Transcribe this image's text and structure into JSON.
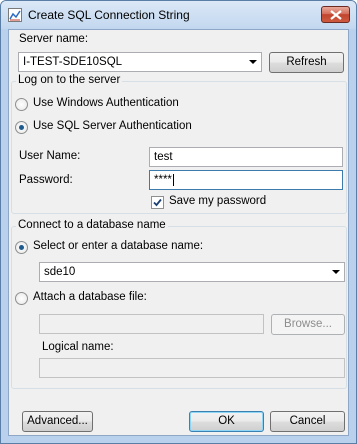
{
  "window": {
    "title": "Create SQL Connection String"
  },
  "server": {
    "label": "Server name:",
    "value": "I-TEST-SDE10SQL",
    "refresh_label": "Refresh"
  },
  "logon": {
    "group_label": "Log on to the server",
    "windows_auth_label": "Use Windows Authentication",
    "sql_auth_label": "Use SQL Server Authentication",
    "selected": "sql",
    "username_label": "User Name:",
    "username_value": "test",
    "password_label": "Password:",
    "password_value": "****",
    "save_password_label": "Save my password",
    "save_password_checked": true
  },
  "database": {
    "group_label": "Connect to a database name",
    "select_label": "Select or enter a database name:",
    "select_value": "sde10",
    "attach_label": "Attach a database file:",
    "attach_value": "",
    "browse_label": "Browse...",
    "logical_name_label": "Logical name:",
    "logical_name_value": "",
    "selected": "select"
  },
  "footer": {
    "advanced_label": "Advanced...",
    "ok_label": "OK",
    "cancel_label": "Cancel"
  },
  "colors": {
    "accent": "#1d5a8e",
    "default_button_border": "#3c7fb1"
  }
}
